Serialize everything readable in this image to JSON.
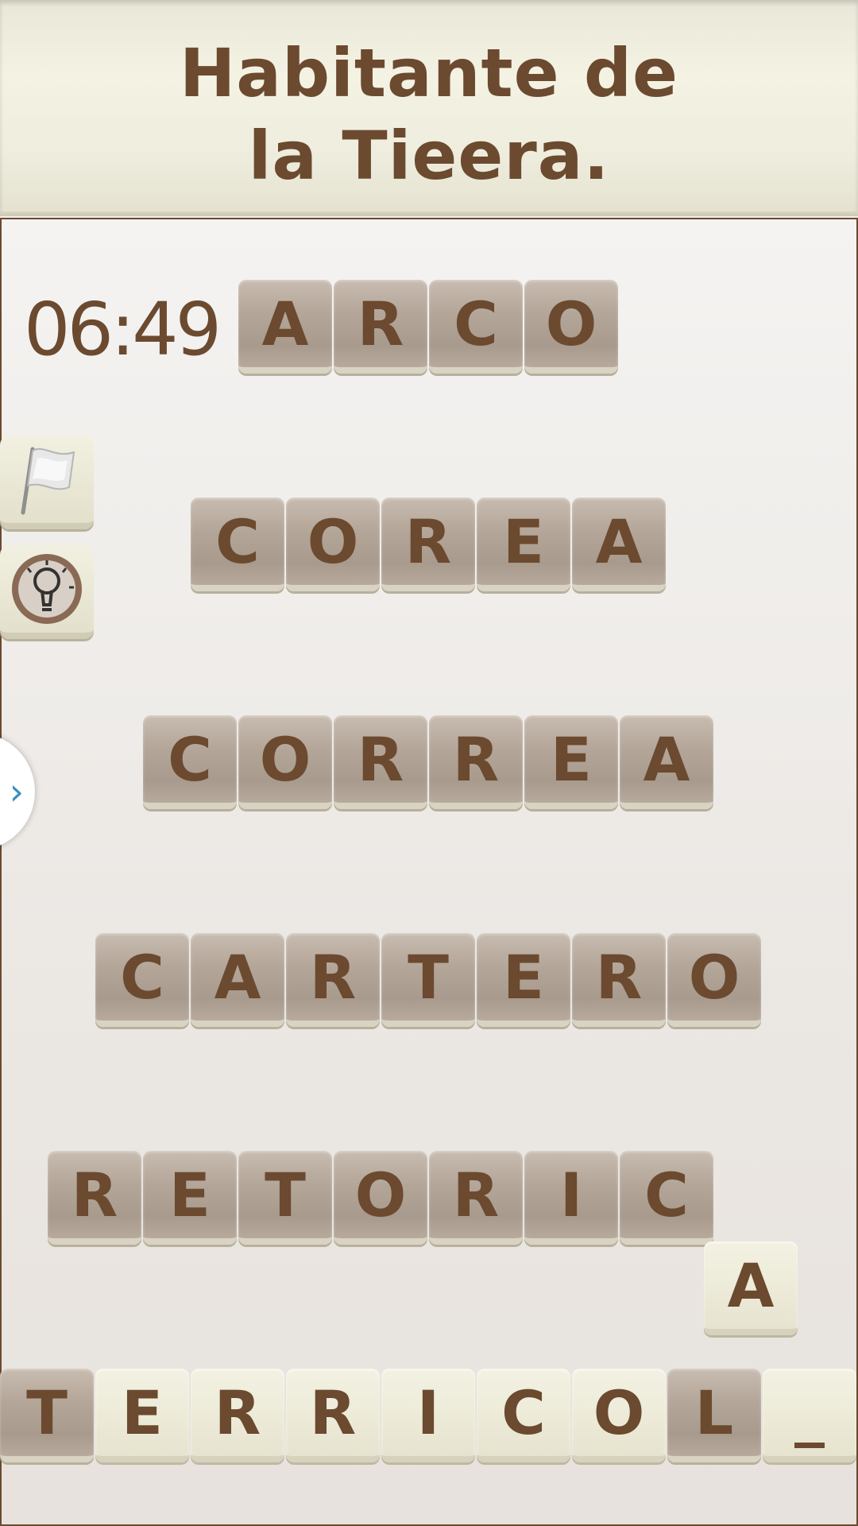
{
  "title_line1": "Habitante de",
  "title_line2": "la Tieera.",
  "timer": "06:49",
  "rows": [
    {
      "letters": [
        "A",
        "R",
        "C",
        "O"
      ]
    },
    {
      "letters": [
        "C",
        "O",
        "R",
        "E",
        "A"
      ]
    },
    {
      "letters": [
        "C",
        "O",
        "R",
        "R",
        "E",
        "A"
      ]
    },
    {
      "letters": [
        "C",
        "A",
        "R",
        "T",
        "E",
        "R",
        "O"
      ]
    },
    {
      "letters": [
        "R",
        "E",
        "T",
        "O",
        "R",
        "I",
        "C"
      ]
    }
  ],
  "extra_tile": "A",
  "answer_row": [
    "T",
    "E",
    "R",
    "R",
    "I",
    "C",
    "O",
    "L",
    "_"
  ],
  "side_buttons": [
    "flag-icon",
    "lightbulb-icon"
  ],
  "drawer_glyph": "›"
}
